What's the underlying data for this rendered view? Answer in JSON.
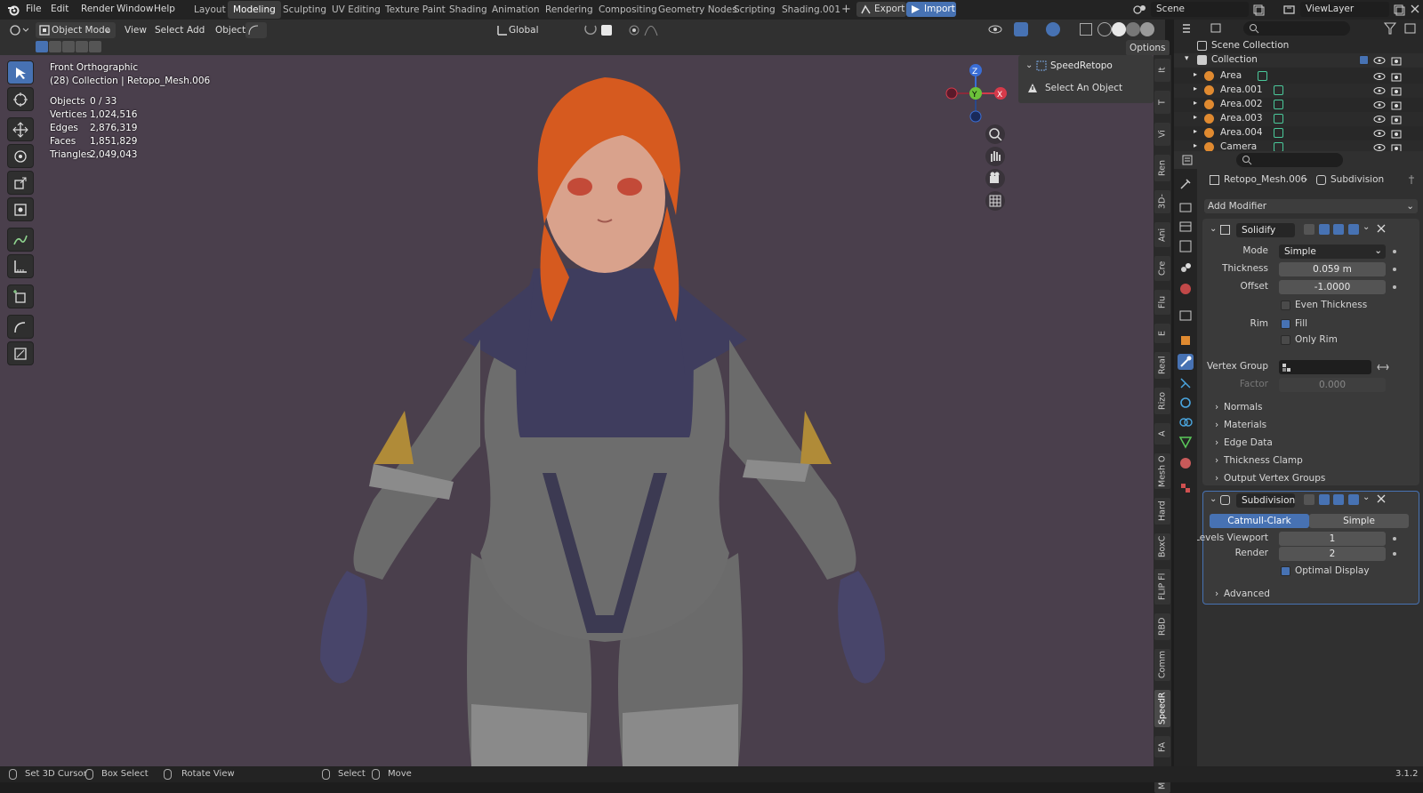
{
  "topbar": {
    "menus": [
      "File",
      "Edit",
      "Render",
      "Window",
      "Help"
    ],
    "workspaces": [
      "Layout",
      "Modeling",
      "Sculpting",
      "UV Editing",
      "Texture Paint",
      "Shading",
      "Animation",
      "Rendering",
      "Compositing",
      "Geometry Nodes",
      "Scripting",
      "Shading.001"
    ],
    "plus": "+",
    "export_label": "Export",
    "import_label": "Import",
    "scene": "Scene",
    "viewlayer": "ViewLayer"
  },
  "vheader": {
    "mode": "Object Mode",
    "menus": [
      "View",
      "Select",
      "Add",
      "Object"
    ],
    "orientation": "Global",
    "options": "Options"
  },
  "viewport": {
    "view_name": "Front Orthographic",
    "collection_info": "(28) Collection | Retopo_Mesh.006",
    "stats": [
      {
        "label": "Objects",
        "value": "0 / 33"
      },
      {
        "label": "Vertices",
        "value": "1,024,516"
      },
      {
        "label": "Edges",
        "value": "2,876,319"
      },
      {
        "label": "Faces",
        "value": "1,851,829"
      },
      {
        "label": "Triangles",
        "value": "2,049,043"
      }
    ],
    "gizmo": {
      "z": "Z",
      "y": "Y",
      "x": "X"
    }
  },
  "npanel": {
    "title": "SpeedRetopo",
    "message": "Select An Object"
  },
  "vtabs": [
    "It",
    "T",
    "Vi",
    "Ren",
    "3D-",
    "Ani",
    "Cre",
    "Flu",
    "E",
    "Real",
    "Rizo",
    "A",
    "Mesh O",
    "Hard",
    "BoxC",
    "FLIP Fl",
    "RBD",
    "Comm",
    "SpeedR",
    "FA",
    "MAC"
  ],
  "outliner": {
    "root": "Scene Collection",
    "collection": "Collection",
    "items": [
      "Area",
      "Area.001",
      "Area.002",
      "Area.003",
      "Area.004",
      "Camera"
    ]
  },
  "properties": {
    "breadcrumb_obj": "Retopo_Mesh.006",
    "breadcrumb_mod": "Subdivision",
    "add_modifier": "Add Modifier",
    "solidify": {
      "name": "Solidify",
      "mode_label": "Mode",
      "mode_value": "Simple",
      "thickness_label": "Thickness",
      "thickness_value": "0.059 m",
      "offset_label": "Offset",
      "offset_value": "-1.0000",
      "even_thickness": "Even Thickness",
      "rim_label": "Rim",
      "fill": "Fill",
      "only_rim": "Only Rim",
      "vgroup_label": "Vertex Group",
      "factor_label": "Factor",
      "factor_value": "0.000",
      "panels": [
        "Normals",
        "Materials",
        "Edge Data",
        "Thickness Clamp",
        "Output Vertex Groups"
      ]
    },
    "subdivision": {
      "name": "Subdivision",
      "tab_a": "Catmull-Clark",
      "tab_b": "Simple",
      "levels_label": "Levels Viewport",
      "levels_value": "1",
      "render_label": "Render",
      "render_value": "2",
      "optimal": "Optimal Display",
      "advanced": "Advanced"
    }
  },
  "status": {
    "items": [
      "Set 3D Cursor",
      "Box Select",
      "Rotate View",
      "Select",
      "Move"
    ],
    "version": "3.1.2"
  }
}
